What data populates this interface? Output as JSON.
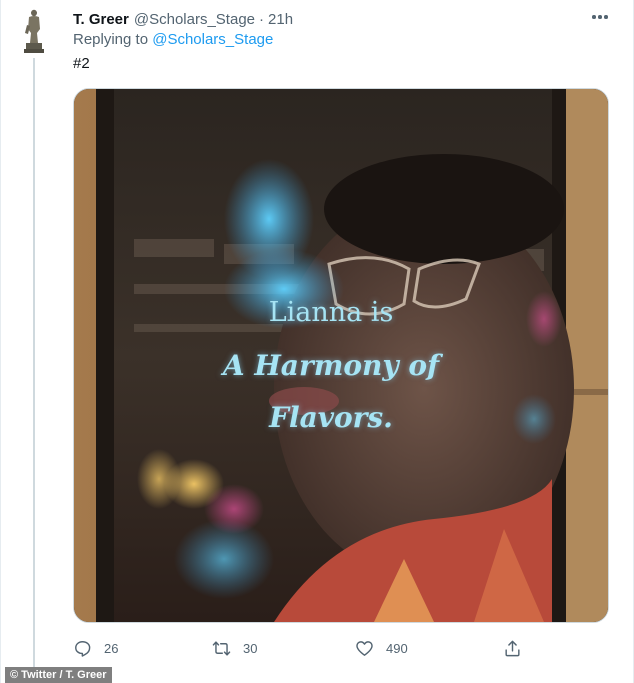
{
  "tweet": {
    "author_name": "T. Greer",
    "author_handle": "@Scholars_Stage",
    "separator": "·",
    "timestamp": "21h",
    "replying_prefix": "Replying to",
    "replying_to": "@Scholars_Stage",
    "text": "#2"
  },
  "media": {
    "ad_line_1": "Lianna is",
    "ad_line_2": "A Harmony of",
    "ad_line_3": "Flavors."
  },
  "actions": {
    "reply_count": "26",
    "retweet_count": "30",
    "like_count": "490"
  },
  "credit": "© Twitter / T. Greer",
  "colors": {
    "link": "#1d9bf0",
    "secondary_text": "#536471",
    "primary_text": "#0f1419",
    "ad_text": "#a6e4f4"
  },
  "icons": [
    "avatar-statue",
    "more-icon",
    "reply-icon",
    "retweet-icon",
    "like-icon",
    "share-icon"
  ]
}
